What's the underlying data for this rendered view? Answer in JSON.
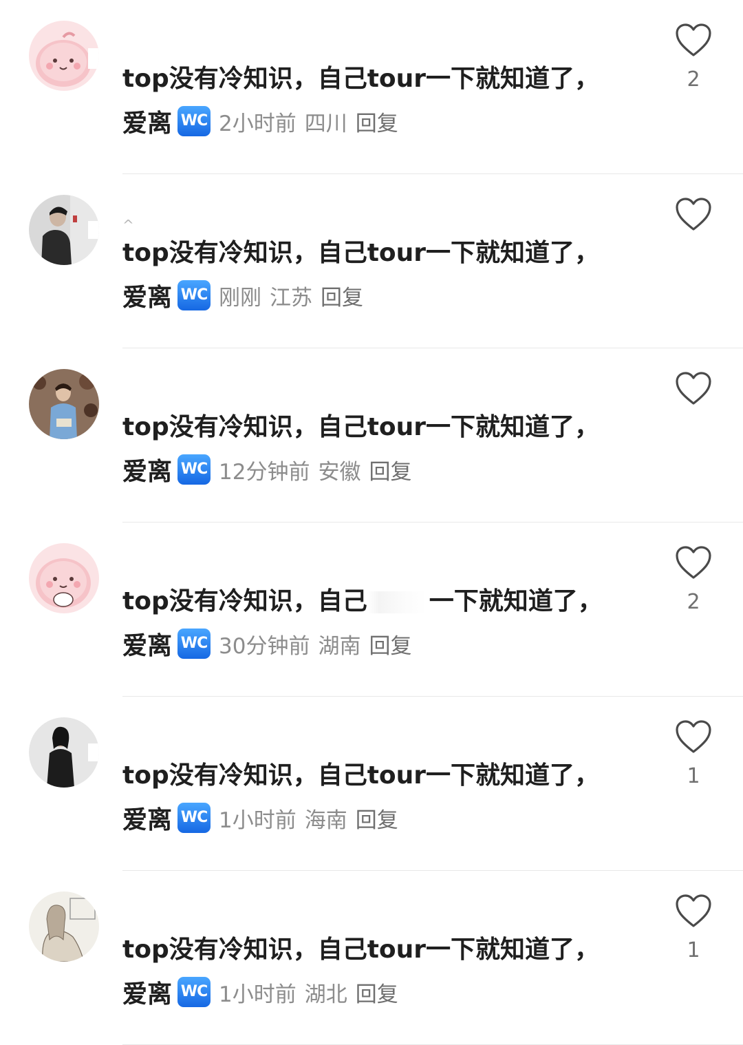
{
  "comments": [
    {
      "username": "",
      "text": "top没有冷知识，自己tour一下就知道了，",
      "author": "爱离",
      "badge": "WC",
      "time": "2小时前",
      "location": "四川",
      "reply_label": "回复",
      "likes": "2"
    },
    {
      "username": "^",
      "text": "top没有冷知识，自己tour一下就知道了，",
      "author": "爱离",
      "badge": "WC",
      "time": "刚刚",
      "location": "江苏",
      "reply_label": "回复",
      "likes": ""
    },
    {
      "username": "",
      "text": "top没有冷知识，自己tour一下就知道了，",
      "author": "爱离",
      "badge": "WC",
      "time": "12分钟前",
      "location": "安徽",
      "reply_label": "回复",
      "likes": ""
    },
    {
      "username": "",
      "text_before": "top没有冷知识，自己",
      "text_after": "一下就知道了，",
      "author": "爱离",
      "badge": "WC",
      "time": "30分钟前",
      "location": "湖南",
      "reply_label": "回复",
      "likes": "2"
    },
    {
      "username": "",
      "text": "top没有冷知识，自己tour一下就知道了，",
      "author": "爱离",
      "badge": "WC",
      "time": "1小时前",
      "location": "海南",
      "reply_label": "回复",
      "likes": "1"
    },
    {
      "username": "",
      "text": "top没有冷知识，自己tour一下就知道了，",
      "author": "爱离",
      "badge": "WC",
      "time": "1小时前",
      "location": "湖北",
      "reply_label": "回复",
      "likes": "1"
    }
  ],
  "icons": {
    "like": "heart-outline-icon"
  },
  "colors": {
    "badge_top": "#49a6ff",
    "badge_bottom": "#1668e3",
    "text_primary": "#1f1f1f",
    "text_secondary": "#8c8c8c"
  }
}
